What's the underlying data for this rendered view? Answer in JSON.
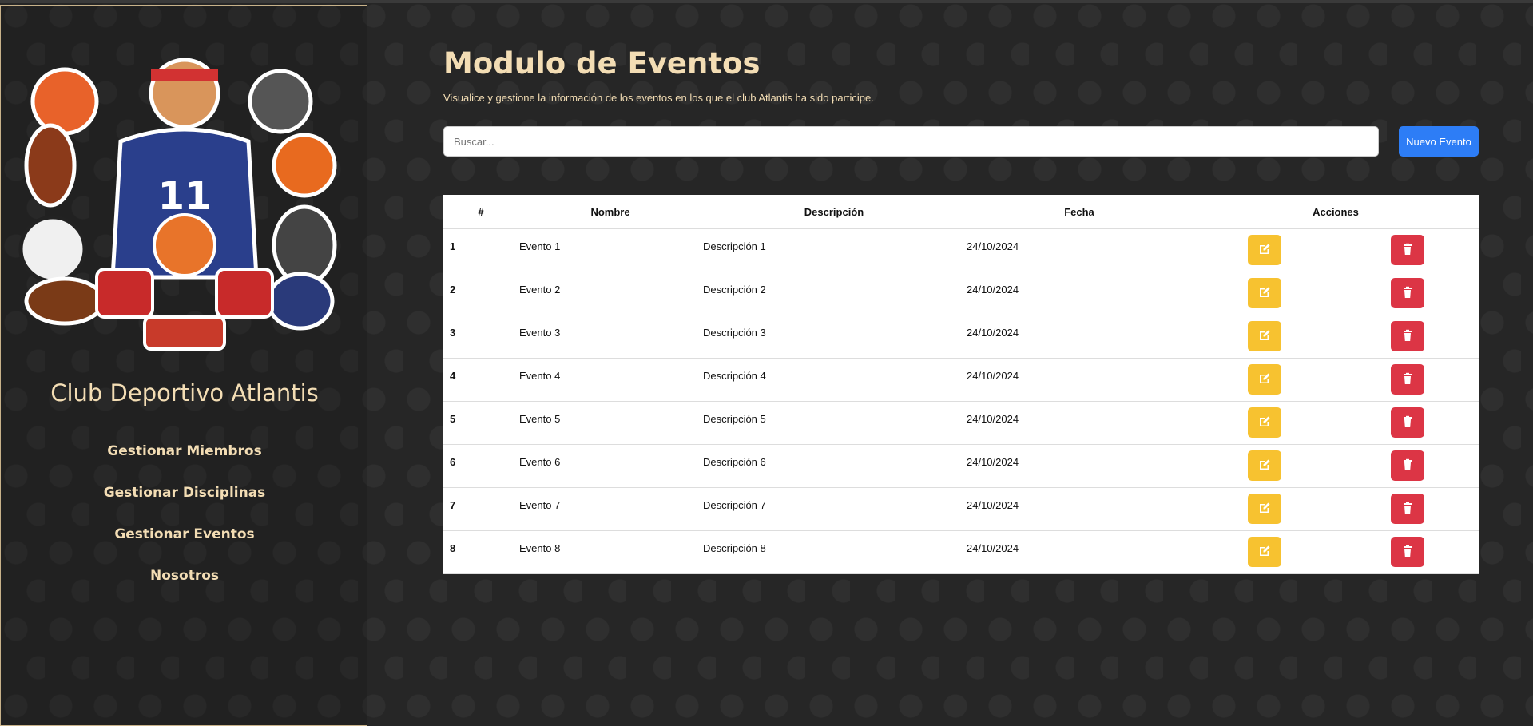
{
  "sidebar": {
    "club_name": "Club Deportivo Atlantis",
    "nav": [
      {
        "label": "Gestionar Miembros"
      },
      {
        "label": "Gestionar Disciplinas"
      },
      {
        "label": "Gestionar Eventos"
      },
      {
        "label": "Nosotros"
      }
    ],
    "logo_icon": "athlete-logo"
  },
  "main": {
    "title": "Modulo de Eventos",
    "subtitle": "Visualice y gestione la información de los eventos en los que el club Atlantis ha sido participe.",
    "search": {
      "placeholder": "Buscar...",
      "value": ""
    },
    "new_button": "Nuevo Evento",
    "table": {
      "headers": [
        "#",
        "Nombre",
        "Descripción",
        "Fecha",
        "Acciones"
      ],
      "rows": [
        {
          "id": "1",
          "name": "Evento 1",
          "desc": "Descripción 1",
          "date": "24/10/2024"
        },
        {
          "id": "2",
          "name": "Evento 2",
          "desc": "Descripción 2",
          "date": "24/10/2024"
        },
        {
          "id": "3",
          "name": "Evento 3",
          "desc": "Descripción 3",
          "date": "24/10/2024"
        },
        {
          "id": "4",
          "name": "Evento 4",
          "desc": "Descripción 4",
          "date": "24/10/2024"
        },
        {
          "id": "5",
          "name": "Evento 5",
          "desc": "Descripción 5",
          "date": "24/10/2024"
        },
        {
          "id": "6",
          "name": "Evento 6",
          "desc": "Descripción 6",
          "date": "24/10/2024"
        },
        {
          "id": "7",
          "name": "Evento 7",
          "desc": "Descripción 7",
          "date": "24/10/2024"
        },
        {
          "id": "8",
          "name": "Evento 8",
          "desc": "Descripción 8",
          "date": "24/10/2024"
        }
      ]
    }
  },
  "colors": {
    "accent": "#f3ddb4",
    "primary": "#2d7df6",
    "edit": "#f7c230",
    "delete": "#dc3545"
  }
}
